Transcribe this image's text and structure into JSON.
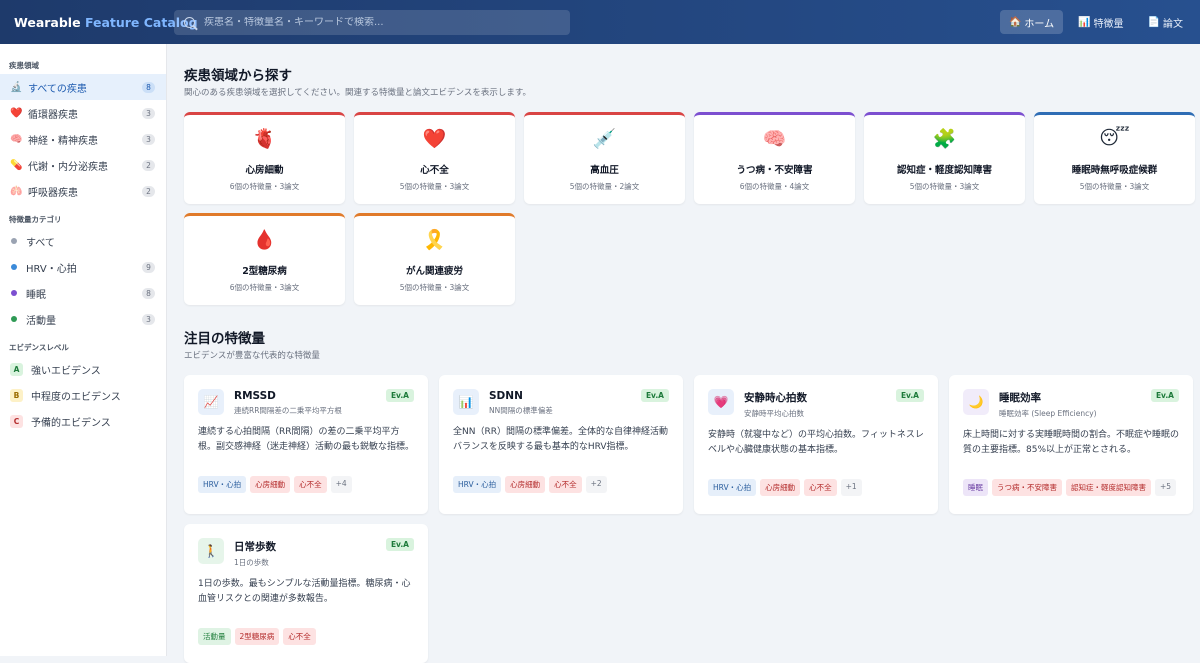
{
  "header": {
    "logo_main": "Wearable",
    "logo_accent": "Feature Catalog",
    "search_placeholder": "疾患名・特徴量名・キーワードで検索...",
    "nav": [
      {
        "icon": "🏠",
        "label": "ホーム",
        "active": true
      },
      {
        "icon": "📊",
        "label": "特徴量",
        "active": false
      },
      {
        "icon": "📄",
        "label": "論文",
        "active": false
      }
    ]
  },
  "sidebar": {
    "disease_heading": "疾患領域",
    "diseases": [
      {
        "icon": "🔬",
        "label": "すべての疾患",
        "count": "8",
        "active": true
      },
      {
        "icon": "❤️",
        "label": "循環器疾患",
        "count": "3"
      },
      {
        "icon": "🧠",
        "label": "神経・精神疾患",
        "count": "3"
      },
      {
        "icon": "💊",
        "label": "代謝・内分泌疾患",
        "count": "2"
      },
      {
        "icon": "🫁",
        "label": "呼吸器疾患",
        "count": "2"
      }
    ],
    "category_heading": "特徴量カテゴリ",
    "categories": [
      {
        "color": "#9aa3b2",
        "label": "すべて",
        "count": ""
      },
      {
        "color": "#3b8ad9",
        "label": "HRV・心拍",
        "count": "9"
      },
      {
        "color": "#7c4fd0",
        "label": "睡眠",
        "count": "8"
      },
      {
        "color": "#2f9a55",
        "label": "活動量",
        "count": "3"
      }
    ],
    "evidence_heading": "エビデンスレベル",
    "evidence": [
      {
        "badge": "A",
        "label": "強いエビデンス",
        "bg": "#d9f3de",
        "fg": "#1d7a3a"
      },
      {
        "badge": "B",
        "label": "中程度のエビデンス",
        "bg": "#fdf1c7",
        "fg": "#9a6b00"
      },
      {
        "badge": "C",
        "label": "予備的エビデンス",
        "bg": "#fde2e2",
        "fg": "#b42c2c"
      }
    ]
  },
  "diseases_section": {
    "title": "疾患領域から探す",
    "subtitle": "関心のある疾患領域を選択してください。関連する特徴量と論文エビデンスを表示します。",
    "cards": [
      {
        "icon": "🫀",
        "name": "心房細動",
        "meta": "6個の特徴量・3論文",
        "color": "#d94444"
      },
      {
        "icon": "❤️",
        "name": "心不全",
        "meta": "5個の特徴量・3論文",
        "color": "#d94444"
      },
      {
        "icon": "💉",
        "name": "高血圧",
        "meta": "5個の特徴量・2論文",
        "color": "#d94444"
      },
      {
        "icon": "🧠",
        "name": "うつ病・不安障害",
        "meta": "6個の特徴量・4論文",
        "color": "#7c4fd0"
      },
      {
        "icon": "🧩",
        "name": "認知症・軽度認知障害",
        "meta": "5個の特徴量・3論文",
        "color": "#7c4fd0"
      },
      {
        "icon": "😴",
        "name": "睡眠時無呼吸症候群",
        "meta": "5個の特徴量・3論文",
        "color": "#2f6db5"
      },
      {
        "icon": "🩸",
        "name": "2型糖尿病",
        "meta": "6個の特徴量・3論文",
        "color": "#e07a2a"
      },
      {
        "icon": "🎗️",
        "name": "がん関連疲労",
        "meta": "5個の特徴量・3論文",
        "color": "#e07a2a"
      }
    ]
  },
  "features_section": {
    "title": "注目の特徴量",
    "subtitle": "エビデンスが豊富な代表的な特徴量",
    "cards": [
      {
        "icon": "📈",
        "icon_bg": "#e8f0fb",
        "name": "RMSSD",
        "sub": "連続RR間隔差の二乗平均平方根",
        "badge": "Ev.A",
        "desc": "連続する心拍間隔（RR間隔）の差の二乗平均平方根。副交感神経（迷走神経）活動の最も鋭敏な指標。",
        "tags": [
          {
            "t": "HRV・心拍",
            "k": "hrv"
          },
          {
            "t": "心房細動",
            "k": "card"
          },
          {
            "t": "心不全",
            "k": "card"
          },
          {
            "t": "+4",
            "k": "more"
          }
        ]
      },
      {
        "icon": "📊",
        "icon_bg": "#e8f0fb",
        "name": "SDNN",
        "sub": "NN間隔の標準偏差",
        "badge": "Ev.A",
        "desc": "全NN（RR）間隔の標準偏差。全体的な自律神経活動バランスを反映する最も基本的なHRV指標。",
        "tags": [
          {
            "t": "HRV・心拍",
            "k": "hrv"
          },
          {
            "t": "心房細動",
            "k": "card"
          },
          {
            "t": "心不全",
            "k": "card"
          },
          {
            "t": "+2",
            "k": "more"
          }
        ]
      },
      {
        "icon": "💗",
        "icon_bg": "#e8f0fb",
        "name": "安静時心拍数",
        "sub": "安静時平均心拍数",
        "badge": "Ev.A",
        "desc": "安静時（就寝中など）の平均心拍数。フィットネスレベルや心臓健康状態の基本指標。",
        "tags": [
          {
            "t": "HRV・心拍",
            "k": "hrv"
          },
          {
            "t": "心房細動",
            "k": "card"
          },
          {
            "t": "心不全",
            "k": "card"
          },
          {
            "t": "+1",
            "k": "more"
          }
        ]
      },
      {
        "icon": "🌙",
        "icon_bg": "#f1ecfa",
        "name": "睡眠効率",
        "sub": "睡眠効率 (Sleep Efficiency)",
        "badge": "Ev.A",
        "desc": "床上時間に対する実睡眠時間の割合。不眠症や睡眠の質の主要指標。85%以上が正常とされる。",
        "tags": [
          {
            "t": "睡眠",
            "k": "sleep"
          },
          {
            "t": "うつ病・不安障害",
            "k": "card"
          },
          {
            "t": "認知症・軽度認知障害",
            "k": "card"
          },
          {
            "t": "+5",
            "k": "more"
          }
        ]
      },
      {
        "icon": "🚶",
        "icon_bg": "#e6f5ea",
        "name": "日常歩数",
        "sub": "1日の歩数",
        "badge": "Ev.A",
        "desc": "1日の歩数。最もシンプルな活動量指標。糖尿病・心血管リスクとの関連が多数報告。",
        "tags": [
          {
            "t": "活動量",
            "k": "act"
          },
          {
            "t": "2型糖尿病",
            "k": "card"
          },
          {
            "t": "心不全",
            "k": "card"
          }
        ]
      }
    ]
  }
}
